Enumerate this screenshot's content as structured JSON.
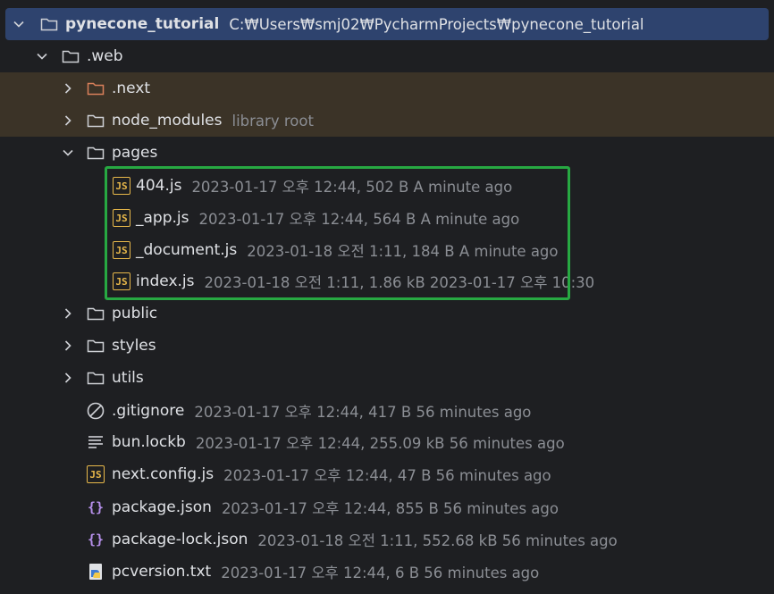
{
  "project": {
    "name": "pynecone_tutorial",
    "path": "C:₩Users₩smj02₩PycharmProjects₩pynecone_tutorial"
  },
  "tree": {
    "web": {
      "name": ".web"
    },
    "next": {
      "name": ".next"
    },
    "node_modules": {
      "name": "node_modules",
      "tag": "library root"
    },
    "pages": {
      "name": "pages"
    },
    "files_pages": [
      {
        "name": "404.js",
        "meta": "2023-01-17 오후 12:44, 502 B A minute ago"
      },
      {
        "name": "_app.js",
        "meta": "2023-01-17 오후 12:44, 564 B A minute ago"
      },
      {
        "name": "_document.js",
        "meta": "2023-01-18 오전 1:11, 184 B A minute ago"
      },
      {
        "name": "index.js",
        "meta": "2023-01-18 오전 1:11, 1.86 kB 2023-01-17 오후 10:30"
      }
    ],
    "public": {
      "name": "public"
    },
    "styles": {
      "name": "styles"
    },
    "utils": {
      "name": "utils"
    },
    "files_web": [
      {
        "name": ".gitignore",
        "meta": "2023-01-17 오후 12:44, 417 B 56 minutes ago",
        "icon": "ignore-icon"
      },
      {
        "name": "bun.lockb",
        "meta": "2023-01-17 오후 12:44, 255.09 kB 56 minutes ago",
        "icon": "text-file-icon"
      },
      {
        "name": "next.config.js",
        "meta": "2023-01-17 오후 12:44, 47 B 56 minutes ago",
        "icon": "js-file-icon"
      },
      {
        "name": "package.json",
        "meta": "2023-01-17 오후 12:44, 855 B 56 minutes ago",
        "icon": "json-file-icon"
      },
      {
        "name": "package-lock.json",
        "meta": "2023-01-18 오전 1:11, 552.68 kB 56 minutes ago",
        "icon": "json-file-icon"
      },
      {
        "name": "pcversion.txt",
        "meta": "2023-01-17 오후 12:44, 6 B 56 minutes ago",
        "icon": "python-file-icon"
      }
    ],
    "js_badge": "JS"
  },
  "colors": {
    "background": "#1e1f22",
    "selected_row": "#2e436e",
    "excluded_row": "#3b3327",
    "highlight_border": "#27a842",
    "js_icon": "#e8b84a",
    "json_icon": "#b48ee8",
    "excluded_folder": "#d9805a"
  }
}
